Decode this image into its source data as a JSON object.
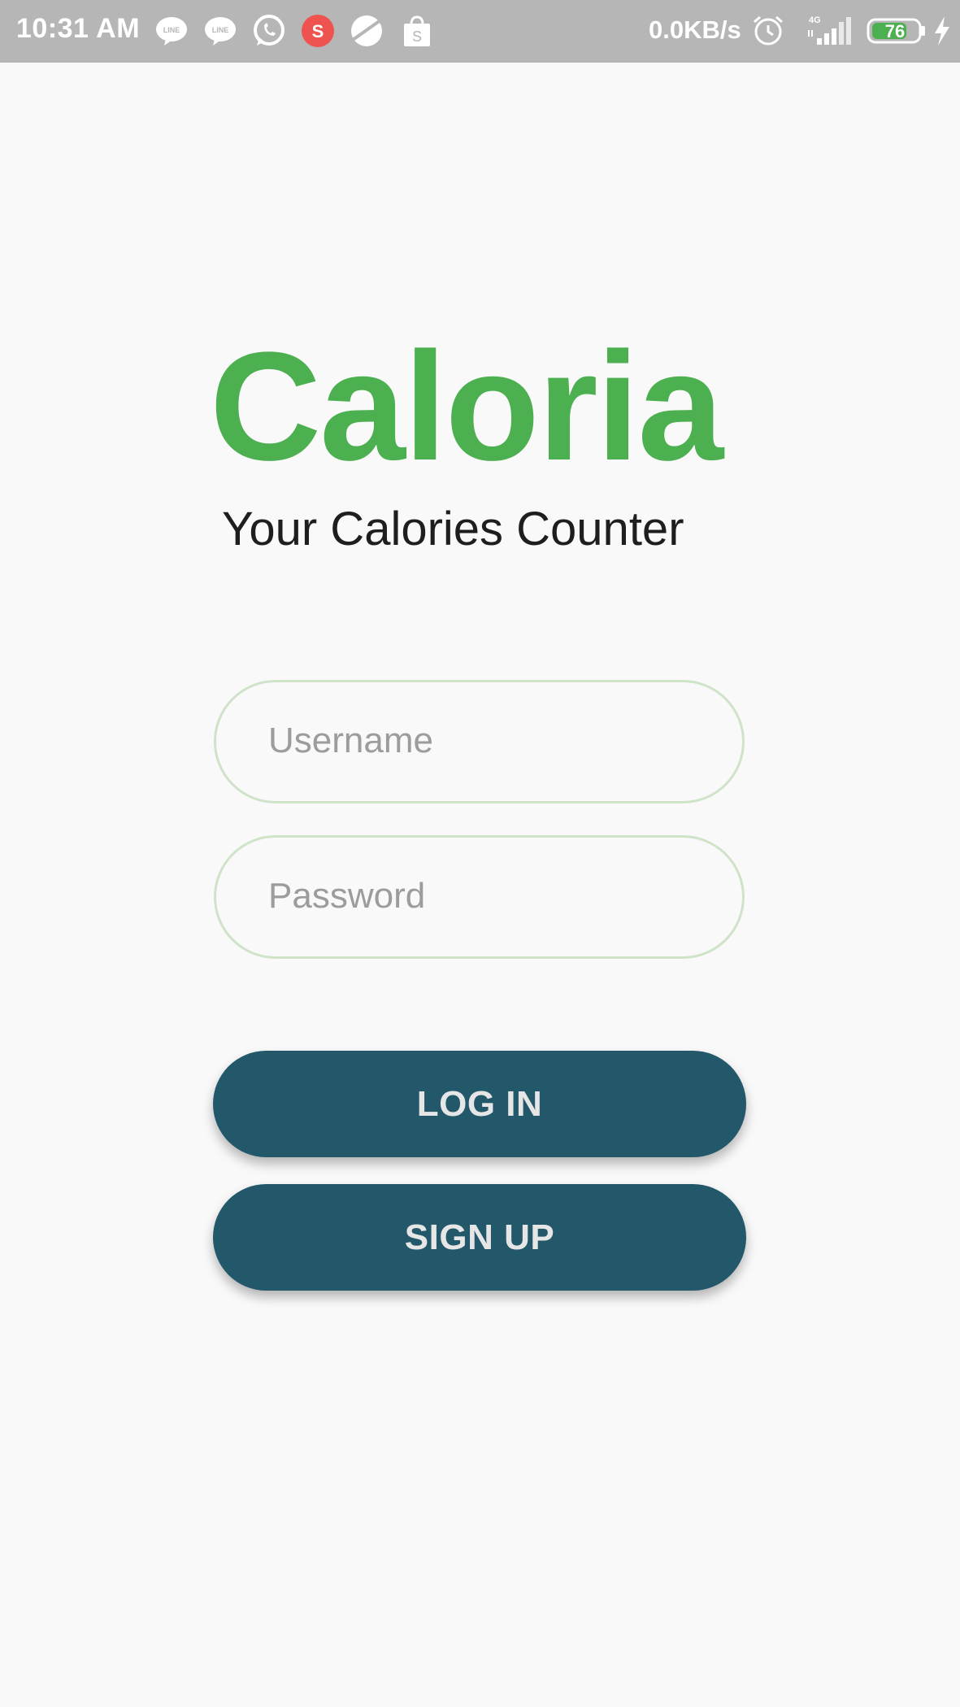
{
  "status_bar": {
    "time": "10:31 AM",
    "network_speed": "0.0KB/s",
    "signal_label": "4G",
    "battery_level": "76",
    "notification_icons": [
      "line-icon",
      "line-icon",
      "whatsapp-icon",
      "shopee-s-icon",
      "planet-icon",
      "shopping-bag-icon"
    ],
    "system_icons": [
      "alarm-icon",
      "signal-icon",
      "battery-icon",
      "charging-icon"
    ],
    "line_badge": "LINE",
    "shopee_badge": "S"
  },
  "app": {
    "name": "Caloria",
    "tagline": "Your Calories Counter",
    "brand_color": "#4caf50",
    "button_color": "#22586a"
  },
  "form": {
    "username": {
      "value": "",
      "placeholder": "Username"
    },
    "password": {
      "value": "",
      "placeholder": "Password"
    }
  },
  "actions": {
    "login_label": "LOG IN",
    "signup_label": "SIGN UP"
  }
}
